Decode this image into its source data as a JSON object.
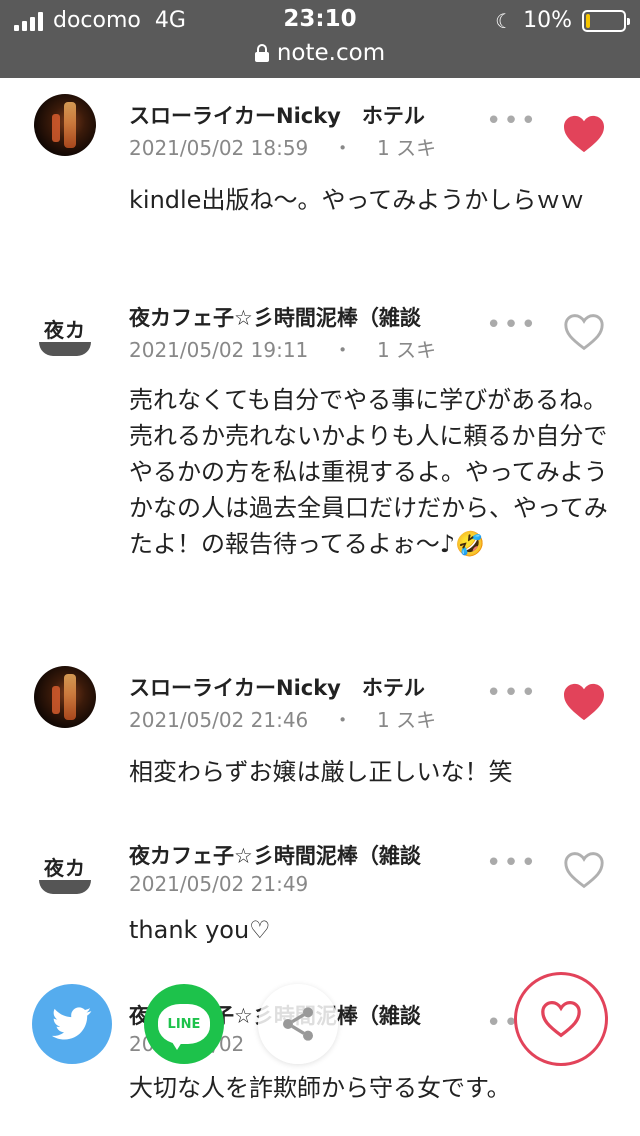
{
  "status_bar": {
    "carrier": "docomo",
    "network": "4G",
    "time": "23:10",
    "url": "note.com",
    "battery": "10%",
    "battery_level": 0.1
  },
  "comments": [
    {
      "author": "スローライカーNicky　ホテル",
      "date": "2021/05/02 18:59",
      "separator": "・",
      "likes": "1 スキ",
      "text": "kindle出版ね〜。やってみようかしらｗｗ",
      "liked": true,
      "avatar": "photo-avatar"
    },
    {
      "author": "夜カフェ子☆彡時間泥棒（雑談",
      "date": "2021/05/02 19:11",
      "separator": "・",
      "likes": "1 スキ",
      "text": "売れなくても自分でやる事に学びがあるね。売れるか売れないかよりも人に頼るか自分でやるかの方を私は重視するよ。やってみようかなの人は過去全員口だけだから、やってみたよ！の報告待ってるよぉ〜♪🤣",
      "liked": false,
      "avatar_text": "夜カ"
    },
    {
      "author": "スローライカーNicky　ホテル",
      "date": "2021/05/02 21:46",
      "separator": "・",
      "likes": "1 スキ",
      "text": "相変わらずお嬢は厳し正しいな！笑",
      "liked": true,
      "avatar": "photo-avatar"
    },
    {
      "author": "夜カフェ子☆彡時間泥棒（雑談",
      "date": "2021/05/02 21:49",
      "separator": "",
      "likes": "",
      "text": "thank you♡",
      "liked": false,
      "avatar_text": "夜カ"
    },
    {
      "author": "夜カフェ子☆彡時間泥棒（雑談",
      "date": "2021/05/02",
      "separator": "",
      "likes": "",
      "text": "大切な人を詐欺師から守る女です。",
      "liked": false,
      "avatar_text": "夜カ"
    }
  ],
  "share_bar": {
    "twitter_icon": "twitter-bird-icon",
    "line_label": "LINE",
    "share_icon": "share-icon",
    "like_icon": "heart-outline-icon"
  },
  "colors": {
    "status_bar_bg": "#5a5a5a",
    "heart_liked": "#e2435a",
    "heart_outline": "#b0b0b0",
    "twitter": "#55acee",
    "line": "#1dc24b"
  }
}
